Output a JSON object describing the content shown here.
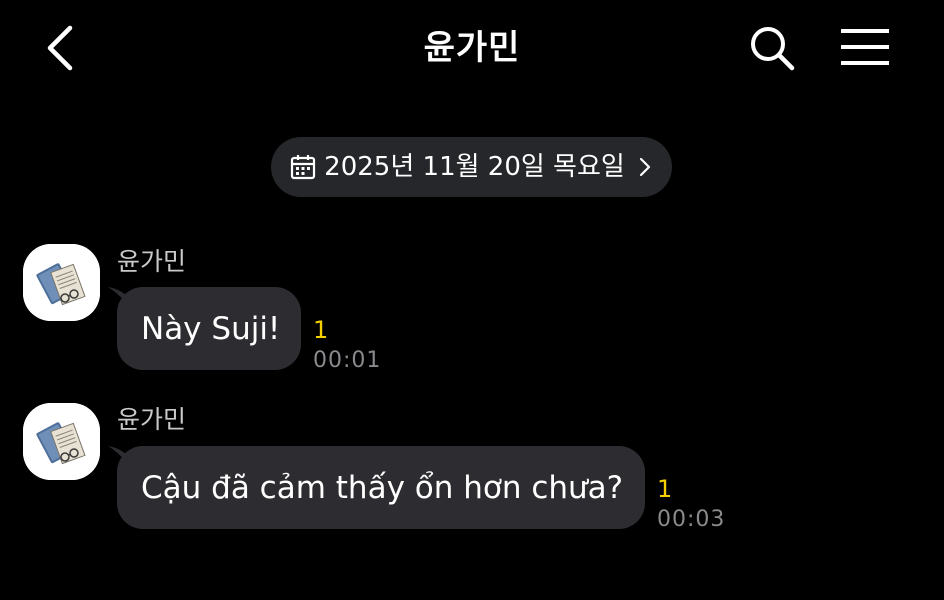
{
  "header": {
    "title": "윤가민",
    "back_icon": "chevron-left-icon",
    "search_icon": "search-icon",
    "menu_icon": "hamburger-menu-icon"
  },
  "date_divider": {
    "icon": "calendar-icon",
    "text": "2025년 11월 20일 목요일",
    "chevron": "chevron-right-icon"
  },
  "messages": [
    {
      "sender": "윤가민",
      "text": "Này Suji!",
      "unread_count": "1",
      "time": "00:01"
    },
    {
      "sender": "윤가민",
      "text": "Cậu đã cảm thấy ổn hơn chưa?",
      "unread_count": "1",
      "time": "00:03"
    }
  ],
  "colors": {
    "background": "#000000",
    "bubble": "#2d2d31",
    "date_pill": "#26272b",
    "unread": "#f5d000",
    "time": "#8a8a8e"
  }
}
